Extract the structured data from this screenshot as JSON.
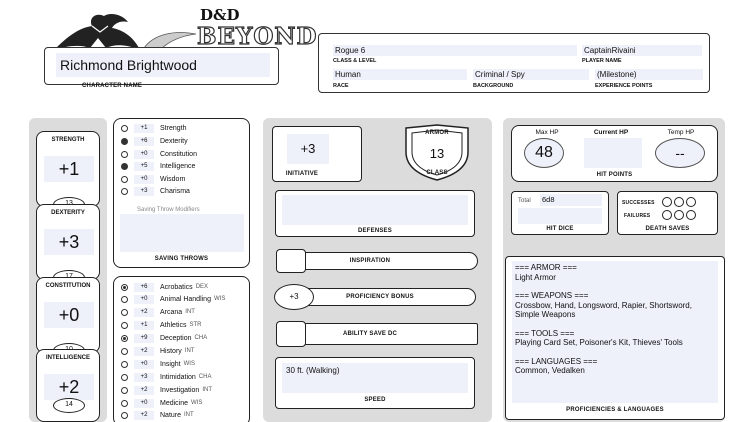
{
  "header": {
    "logo_top": "D&D",
    "logo_bottom": "BEYOND",
    "character_name": "Richmond Brightwood",
    "character_name_label": "CHARACTER NAME",
    "class_level": "Rogue 6",
    "class_level_label": "CLASS & LEVEL",
    "player_name": "CaptainRivaini",
    "player_name_label": "PLAYER NAME",
    "race": "Human",
    "race_label": "RACE",
    "background": "Criminal / Spy",
    "background_label": "BACKGROUND",
    "experience": "(Milestone)",
    "experience_label": "EXPERIENCE POINTS"
  },
  "abilities": [
    {
      "name": "STRENGTH",
      "mod": "+1",
      "score": "13"
    },
    {
      "name": "DEXTERITY",
      "mod": "+3",
      "score": "17"
    },
    {
      "name": "CONSTITUTION",
      "mod": "+0",
      "score": "10"
    },
    {
      "name": "INTELLIGENCE",
      "mod": "+2",
      "score": "14"
    }
  ],
  "saving_throws": {
    "items": [
      {
        "bonus": "+1",
        "name": "Strength",
        "proficient": false
      },
      {
        "bonus": "+6",
        "name": "Dexterity",
        "proficient": true
      },
      {
        "bonus": "+0",
        "name": "Constitution",
        "proficient": false
      },
      {
        "bonus": "+5",
        "name": "Intelligence",
        "proficient": true
      },
      {
        "bonus": "+0",
        "name": "Wisdom",
        "proficient": false
      },
      {
        "bonus": "+3",
        "name": "Charisma",
        "proficient": false
      }
    ],
    "modifiers_label": "Saving Throw Modifiers",
    "title": "SAVING THROWS"
  },
  "skills": [
    {
      "bonus": "+6",
      "name": "Acrobatics",
      "attr": "DEX",
      "mark": "expert"
    },
    {
      "bonus": "+0",
      "name": "Animal Handling",
      "attr": "WIS",
      "mark": "none"
    },
    {
      "bonus": "+2",
      "name": "Arcana",
      "attr": "INT",
      "mark": "none"
    },
    {
      "bonus": "+1",
      "name": "Athletics",
      "attr": "STR",
      "mark": "none"
    },
    {
      "bonus": "+9",
      "name": "Deception",
      "attr": "CHA",
      "mark": "expert"
    },
    {
      "bonus": "+2",
      "name": "History",
      "attr": "INT",
      "mark": "none"
    },
    {
      "bonus": "+0",
      "name": "Insight",
      "attr": "WIS",
      "mark": "none"
    },
    {
      "bonus": "+3",
      "name": "Intimidation",
      "attr": "CHA",
      "mark": "none"
    },
    {
      "bonus": "+2",
      "name": "Investigation",
      "attr": "INT",
      "mark": "none"
    },
    {
      "bonus": "+0",
      "name": "Medicine",
      "attr": "WIS",
      "mark": "none"
    },
    {
      "bonus": "+2",
      "name": "Nature",
      "attr": "INT",
      "mark": "none"
    }
  ],
  "combat": {
    "initiative": "+3",
    "initiative_label": "INITIATIVE",
    "armor_top": "ARMOR",
    "armor_class": "13",
    "armor_bottom": "CLASS",
    "defenses_label": "DEFENSES",
    "inspiration_label": "INSPIRATION",
    "proficiency": "+3",
    "proficiency_label": "PROFICIENCY BONUS",
    "save_dc_label": "ABILITY SAVE DC",
    "speed": "30 ft. (Walking)",
    "speed_label": "SPEED"
  },
  "hp": {
    "max_label": "Max HP",
    "max": "48",
    "current_label": "Current HP",
    "temp_label": "Temp HP",
    "temp": "--",
    "title": "HIT POINTS",
    "hit_dice_total_label": "Total",
    "hit_dice": "6d8",
    "hit_dice_label": "HIT DICE",
    "successes_label": "SUCCESSES",
    "failures_label": "FAILURES",
    "death_saves_label": "DEATH SAVES"
  },
  "proficiencies": {
    "armor_head": "=== ARMOR ===",
    "armor": "Light Armor",
    "weapons_head": "=== WEAPONS ===",
    "weapons": "Crossbow, Hand, Longsword, Rapier, Shortsword, Simple Weapons",
    "tools_head": "=== TOOLS ===",
    "tools": "Playing Card Set, Poisoner's Kit, Thieves' Tools",
    "languages_head": "=== LANGUAGES ===",
    "languages": "Common, Vedalken",
    "title": "PROFICIENCIES & LANGUAGES"
  }
}
